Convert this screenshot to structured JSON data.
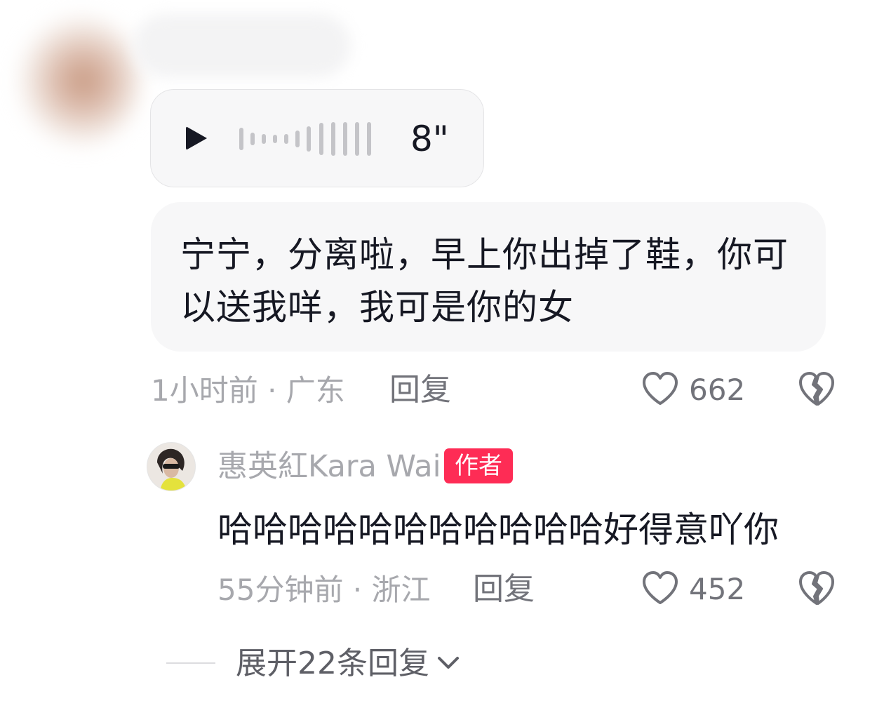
{
  "comment": {
    "voice_duration": "8\"",
    "text": "宁宁，分离啦，早上你出掉了鞋，你可以送我咩，我可是你的女",
    "meta": "1小时前 · 广东",
    "reply_label": "回复",
    "like_count": "662"
  },
  "reply": {
    "username": "惠英紅Kara Wai",
    "badge": "作者",
    "text": "哈哈哈哈哈哈哈哈哈哈哈好得意吖你",
    "meta": "55分钟前 · 浙江",
    "reply_label": "回复",
    "like_count": "452"
  },
  "expand_replies_label": "展开22条回复",
  "icons": {
    "play": "play-icon",
    "waveform": "waveform-icon",
    "like": "heart-outline-icon",
    "dislike": "broken-heart-icon",
    "expand": "chevron-down-icon"
  },
  "colors": {
    "author_badge": "#fe2c55",
    "text_primary": "#161823",
    "text_secondary": "#a7a8ad",
    "bubble_background": "#f7f7f8"
  }
}
